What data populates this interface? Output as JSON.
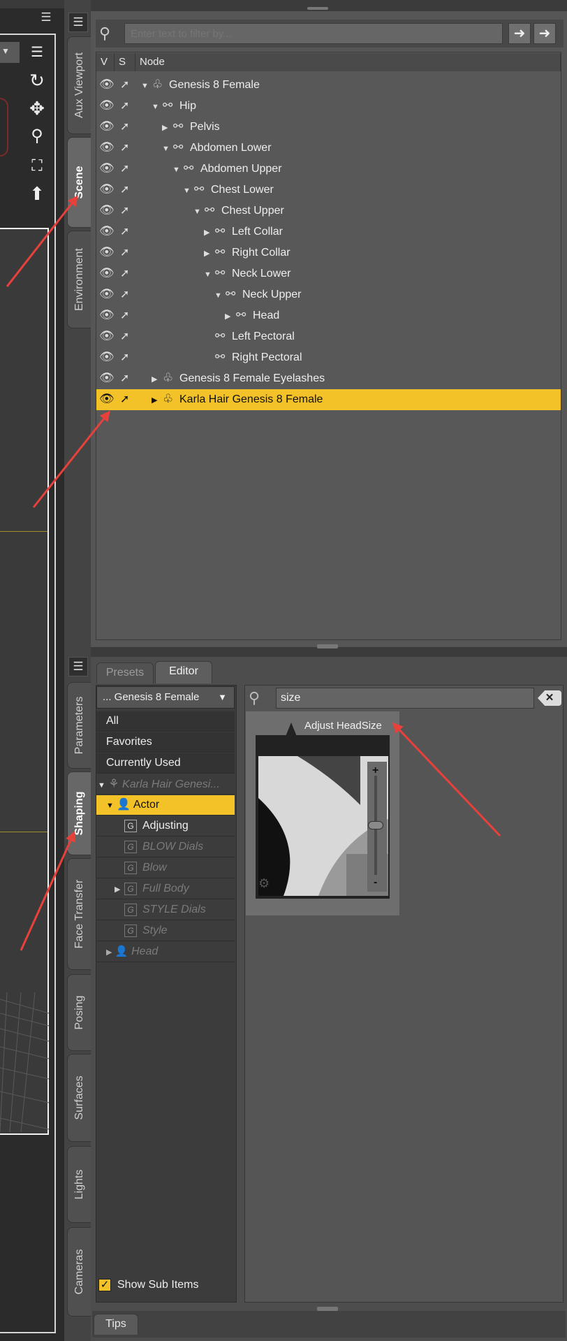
{
  "vertical_tabs_top": [
    {
      "label": "Aux Viewport",
      "active": false
    },
    {
      "label": "Scene",
      "active": true
    },
    {
      "label": "Environment",
      "active": false
    }
  ],
  "vertical_tabs_bottom": [
    {
      "label": "Parameters",
      "active": false
    },
    {
      "label": "Shaping",
      "active": true
    },
    {
      "label": "Face Transfer",
      "active": false
    },
    {
      "label": "Posing",
      "active": false
    },
    {
      "label": "Surfaces",
      "active": false
    },
    {
      "label": "Lights",
      "active": false
    },
    {
      "label": "Cameras",
      "active": false
    }
  ],
  "scene": {
    "search_placeholder": "Enter text to filter by...",
    "columns": [
      "V",
      "S",
      "Node"
    ],
    "nodes": [
      {
        "label": "Genesis 8 Female",
        "icon": "figure-icon",
        "twisty": "▼",
        "depth": 0,
        "selected": false
      },
      {
        "label": "Hip",
        "icon": "bone-icon",
        "twisty": "▼",
        "depth": 1,
        "selected": false
      },
      {
        "label": "Pelvis",
        "icon": "bone-icon",
        "twisty": "▶",
        "depth": 2,
        "selected": false
      },
      {
        "label": "Abdomen Lower",
        "icon": "bone-icon",
        "twisty": "▼",
        "depth": 2,
        "selected": false
      },
      {
        "label": "Abdomen Upper",
        "icon": "bone-icon",
        "twisty": "▼",
        "depth": 3,
        "selected": false
      },
      {
        "label": "Chest Lower",
        "icon": "bone-icon",
        "twisty": "▼",
        "depth": 4,
        "selected": false
      },
      {
        "label": "Chest Upper",
        "icon": "bone-icon",
        "twisty": "▼",
        "depth": 5,
        "selected": false
      },
      {
        "label": "Left Collar",
        "icon": "bone-icon",
        "twisty": "▶",
        "depth": 6,
        "selected": false
      },
      {
        "label": "Right Collar",
        "icon": "bone-icon",
        "twisty": "▶",
        "depth": 6,
        "selected": false
      },
      {
        "label": "Neck Lower",
        "icon": "bone-icon",
        "twisty": "▼",
        "depth": 6,
        "selected": false
      },
      {
        "label": "Neck Upper",
        "icon": "bone-icon",
        "twisty": "▼",
        "depth": 7,
        "selected": false
      },
      {
        "label": "Head",
        "icon": "bone-icon",
        "twisty": "▶",
        "depth": 8,
        "selected": false
      },
      {
        "label": "Left Pectoral",
        "icon": "bone-icon",
        "twisty": "",
        "depth": 6,
        "selected": false
      },
      {
        "label": "Right Pectoral",
        "icon": "bone-icon",
        "twisty": "",
        "depth": 6,
        "selected": false
      },
      {
        "label": "Genesis 8 Female Eyelashes",
        "icon": "figure-icon",
        "twisty": "▶",
        "depth": 1,
        "selected": false
      },
      {
        "label": "Karla Hair Genesis 8 Female",
        "icon": "figure-icon",
        "twisty": "▶",
        "depth": 1,
        "selected": true
      }
    ]
  },
  "shaping": {
    "tabs": [
      "Presets",
      "Editor"
    ],
    "active_tab": "Editor",
    "figure_select": "... Genesis 8 Female",
    "filters": [
      "All",
      "Favorites",
      "Currently Used"
    ],
    "tree": {
      "root": "Karla Hair Genesi...",
      "actor": "Actor",
      "groups": [
        {
          "label": "Adjusting",
          "dim": false,
          "twisty": ""
        },
        {
          "label": "BLOW Dials",
          "dim": true,
          "twisty": ""
        },
        {
          "label": "Blow",
          "dim": true,
          "twisty": ""
        },
        {
          "label": "Full Body",
          "dim": true,
          "twisty": "▶"
        },
        {
          "label": "STYLE Dials",
          "dim": true,
          "twisty": ""
        },
        {
          "label": "Style",
          "dim": true,
          "twisty": ""
        }
      ],
      "head": "Head"
    },
    "search_value": "size",
    "param_label": "Adjust HeadSize",
    "param_value_fraction": 0.5,
    "show_sub_items": "Show Sub Items",
    "show_sub_items_checked": true,
    "tips_tab": "Tips"
  },
  "colors": {
    "selection": "#f3c229",
    "arrow": "#e8413c"
  }
}
